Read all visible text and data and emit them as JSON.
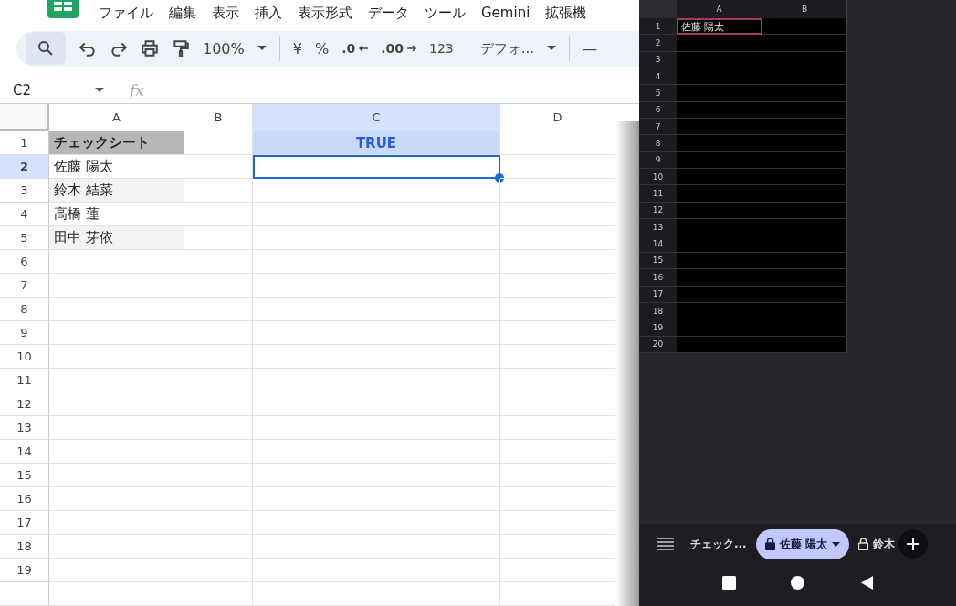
{
  "menu": [
    "ファイル",
    "編集",
    "表示",
    "挿入",
    "表示形式",
    "データ",
    "ツール",
    "Gemini",
    "拡張機"
  ],
  "toolbar": {
    "zoom": "100%",
    "currency": "¥",
    "percent": "%",
    "decrease_decimal": ".0",
    "increase_decimal": ".00",
    "number_format": "123",
    "font": "デフォ...",
    "font_size_minus": "—"
  },
  "name_box": "C2",
  "formula_label": "fx",
  "columns": [
    {
      "label": "A",
      "selected": false
    },
    {
      "label": "B",
      "selected": false
    },
    {
      "label": "C",
      "selected": true
    },
    {
      "label": "D",
      "selected": false
    }
  ],
  "rows": [
    {
      "number": "1",
      "selected": false,
      "a": "チェックシート",
      "a_bold": true,
      "c": "TRUE"
    },
    {
      "number": "2",
      "selected": true,
      "a": "佐藤 陽太",
      "c_active": true
    },
    {
      "number": "3",
      "selected": false,
      "a": "鈴木 結菜",
      "a_shaded": true
    },
    {
      "number": "4",
      "selected": false,
      "a": "高橋 蓮"
    },
    {
      "number": "5",
      "selected": false,
      "a": "田中 芽依",
      "a_shaded": true
    },
    {
      "number": "6",
      "selected": false
    },
    {
      "number": "7",
      "selected": false
    },
    {
      "number": "8",
      "selected": false
    },
    {
      "number": "9",
      "selected": false
    },
    {
      "number": "10",
      "selected": false
    },
    {
      "number": "11",
      "selected": false
    },
    {
      "number": "12",
      "selected": false
    },
    {
      "number": "13",
      "selected": false
    },
    {
      "number": "14",
      "selected": false
    },
    {
      "number": "15",
      "selected": false
    },
    {
      "number": "16",
      "selected": false
    },
    {
      "number": "17",
      "selected": false
    },
    {
      "number": "18",
      "selected": false
    },
    {
      "number": "19",
      "selected": false
    }
  ],
  "phone": {
    "columns": [
      "A",
      "B"
    ],
    "rows": [
      {
        "number": "1",
        "a": "佐藤 陽太",
        "selected": true
      },
      {
        "number": "2",
        "selected": false
      },
      {
        "number": "3",
        "selected": false
      },
      {
        "number": "4",
        "selected": false
      },
      {
        "number": "5",
        "selected": false
      },
      {
        "number": "6",
        "selected": false
      },
      {
        "number": "7",
        "selected": false
      },
      {
        "number": "8",
        "selected": false
      },
      {
        "number": "9",
        "selected": false
      },
      {
        "number": "10",
        "selected": false
      },
      {
        "number": "11",
        "selected": false
      },
      {
        "number": "12",
        "selected": false
      },
      {
        "number": "13",
        "selected": false
      },
      {
        "number": "14",
        "selected": false
      },
      {
        "number": "15",
        "selected": false
      },
      {
        "number": "16",
        "selected": false
      },
      {
        "number": "17",
        "selected": false
      },
      {
        "number": "18",
        "selected": false
      },
      {
        "number": "19",
        "selected": false
      },
      {
        "number": "20",
        "selected": false
      }
    ],
    "sheet_tabs": [
      {
        "label": "チェック...",
        "selected": false,
        "locked": false
      },
      {
        "label": "佐藤 陽太",
        "selected": true,
        "locked": true
      },
      {
        "label": "鈴木",
        "selected": false,
        "locked": true
      }
    ]
  }
}
